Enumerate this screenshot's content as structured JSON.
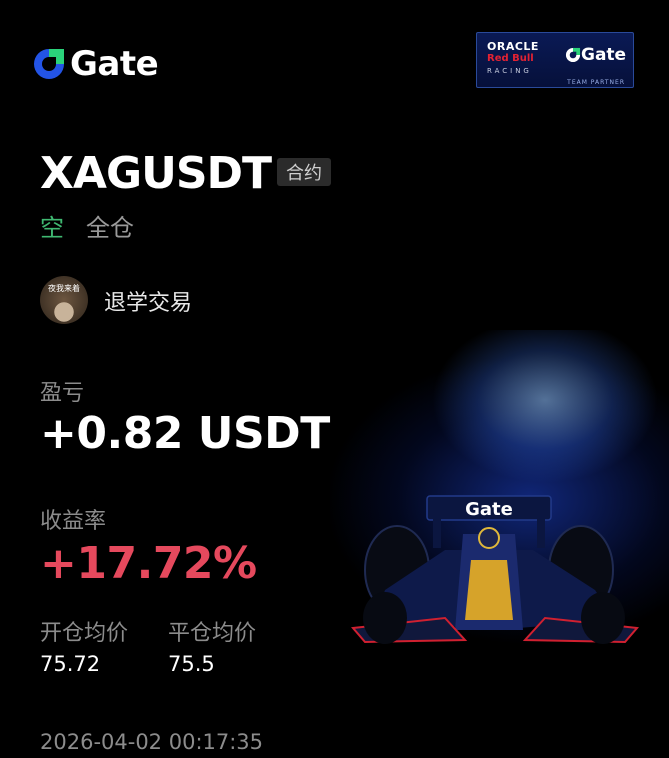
{
  "brand": {
    "logo_text": "Gate",
    "accent": "#2354e6"
  },
  "partner_badge": {
    "line1": "ORACLE",
    "line2": "Red Bull",
    "line3": "RACING",
    "gate_text": "Gate",
    "footer": "TEAM PARTNER"
  },
  "position": {
    "symbol": "XAGUSDT",
    "type_badge": "合约",
    "side": "空",
    "margin_mode": "全仓",
    "side_color": "#3fb871"
  },
  "user": {
    "avatar_text": "夜我来着",
    "name": "退学交易"
  },
  "pnl": {
    "label": "盈亏",
    "value": "+0.82 USDT"
  },
  "roi": {
    "label": "收益率",
    "value": "+17.72%",
    "color": "#e5495d"
  },
  "prices": {
    "open_label": "开仓均价",
    "open_value": "75.72",
    "close_label": "平仓均价",
    "close_value": "75.5"
  },
  "timestamp": "2026-04-02 00:17:35",
  "car_wing_text": "Gate"
}
